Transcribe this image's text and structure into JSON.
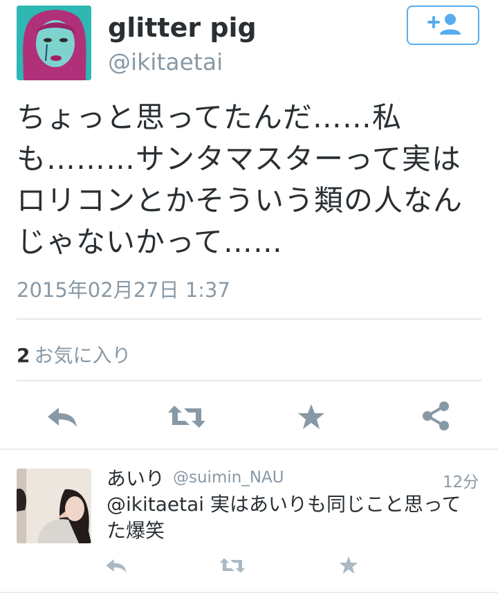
{
  "tweet": {
    "display_name": "glitter pig",
    "handle": "@ikitaetai",
    "text": "ちょっと思ってたんだ……私も………サンタマスターって実はロリコンとかそういう類の人なんじゃないかって……",
    "timestamp": "2015年02月27日 1:37",
    "favorites_count": "2",
    "favorites_label": "お気に入り",
    "follow_icon": "add-user-icon"
  },
  "actions": [
    {
      "icon": "reply-icon"
    },
    {
      "icon": "retweet-icon"
    },
    {
      "icon": "favorite-star-icon"
    },
    {
      "icon": "share-icon"
    }
  ],
  "reply": {
    "display_name": "あいり",
    "handle": "@suimin_NAU",
    "time": "12分",
    "mention": "@ikitaetai",
    "text": "実はあいりも同じこと思ってた爆笑"
  },
  "colors": {
    "accent": "#55acee",
    "text": "#292f33",
    "muted": "#8899a6",
    "icon": "#8899a6",
    "icon_light": "#aab8c2",
    "divider": "#e1e8ed"
  }
}
